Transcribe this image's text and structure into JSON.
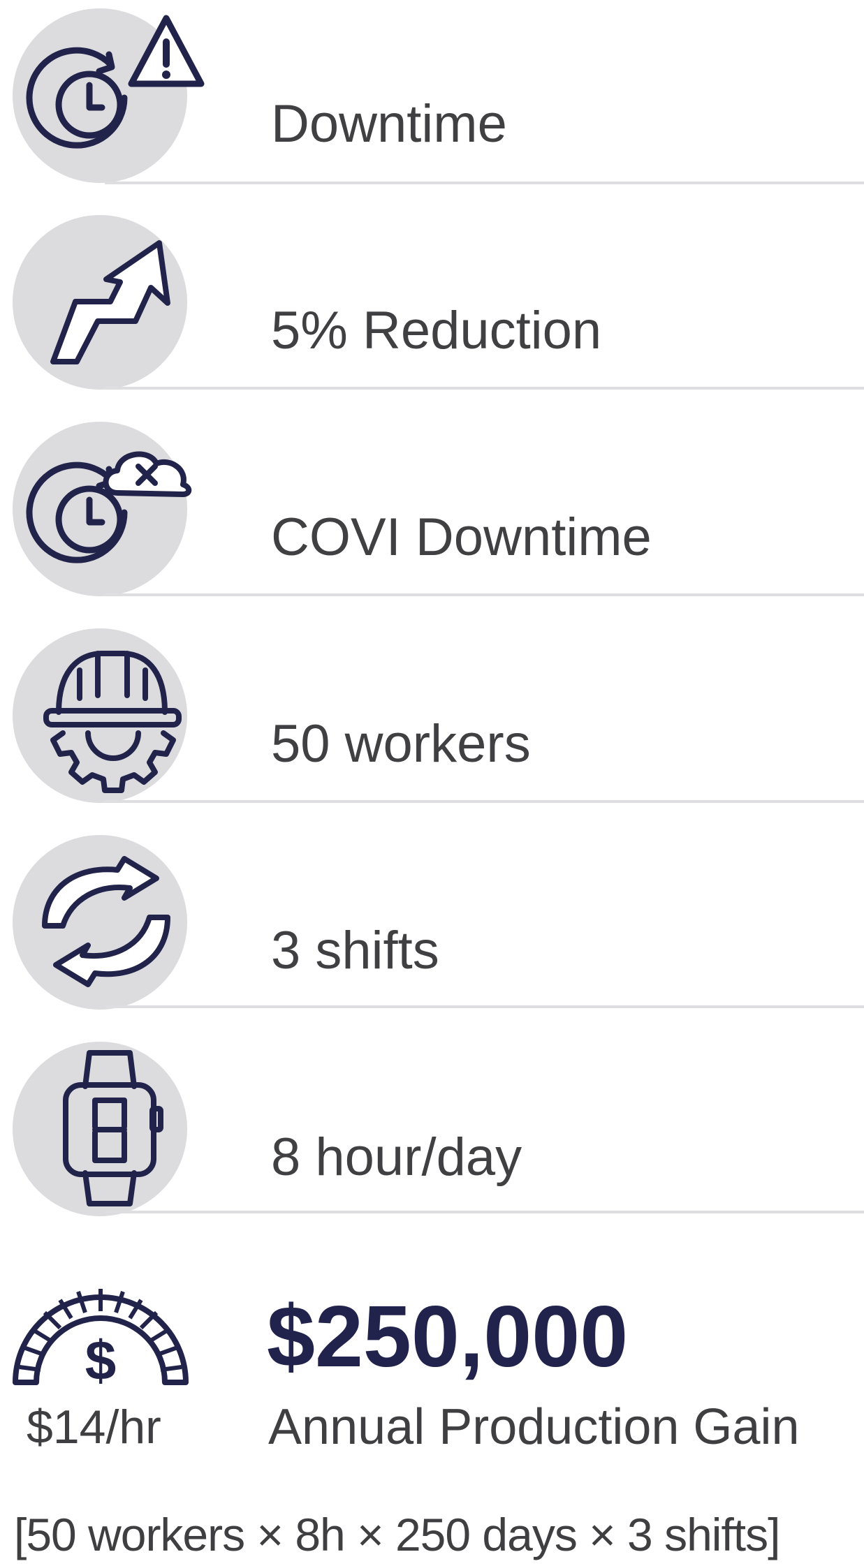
{
  "rows": [
    {
      "label": "Downtime",
      "icon": "clock-alert-icon"
    },
    {
      "label": "5% Reduction",
      "icon": "trend-up-arrow-icon"
    },
    {
      "label": "COVI Downtime",
      "icon": "clock-cloud-icon"
    },
    {
      "label": "50 workers",
      "icon": "worker-helmet-gear-icon"
    },
    {
      "label": "3 shifts",
      "icon": "cycle-arrows-icon"
    },
    {
      "label": "8 hour/day",
      "icon": "digital-watch-icon"
    }
  ],
  "summary": {
    "amount": "$250,000",
    "label": "Annual Production Gain",
    "rate": "$14/hr",
    "gauge_symbol": "$",
    "icon": "dollar-gauge-icon"
  },
  "formula": "[50 workers × 8h × 250 days × 3 shifts]",
  "colors": {
    "icon_stroke": "#22234a",
    "circle_bg": "#dcdcdf",
    "divider": "#dedee0",
    "text": "#404042",
    "amount": "#21234d"
  }
}
